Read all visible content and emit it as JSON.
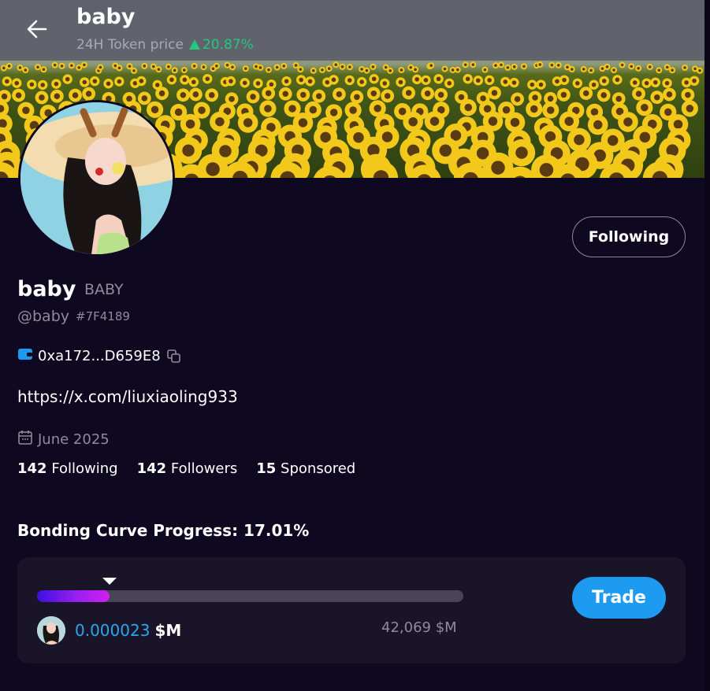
{
  "header": {
    "title": "baby",
    "price_label": "24H Token price",
    "price_change": "20.87%",
    "change_color": "#25c77c"
  },
  "profile": {
    "name": "baby",
    "symbol": "BABY",
    "handle": "@baby",
    "hex_id": "#7F4189",
    "wallet": "0xa172...D659E8",
    "link": "https://x.com/liuxiaoling933",
    "joined": "June 2025",
    "follow_button": "Following"
  },
  "stats": [
    {
      "count": "142",
      "label": "Following"
    },
    {
      "count": "142",
      "label": "Followers"
    },
    {
      "count": "15",
      "label": "Sponsored"
    }
  ],
  "bonding": {
    "title": "Bonding Curve Progress: 17.01%",
    "progress": 0.1701,
    "price_value": "0.000023",
    "price_unit": "$M",
    "market_cap": "42,069 $M",
    "trade_button": "Trade"
  },
  "colors": {
    "background": "#0e0820",
    "accent": "#1d9bf0",
    "price_value": "#28a7f0"
  }
}
